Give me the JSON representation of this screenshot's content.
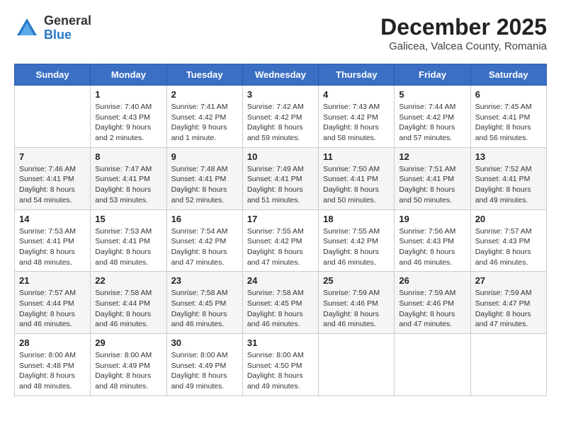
{
  "header": {
    "logo_general": "General",
    "logo_blue": "Blue",
    "month_title": "December 2025",
    "subtitle": "Galicea, Valcea County, Romania"
  },
  "days_of_week": [
    "Sunday",
    "Monday",
    "Tuesday",
    "Wednesday",
    "Thursday",
    "Friday",
    "Saturday"
  ],
  "weeks": [
    [
      {
        "day": "",
        "content": ""
      },
      {
        "day": "1",
        "content": "Sunrise: 7:40 AM\nSunset: 4:43 PM\nDaylight: 9 hours\nand 2 minutes."
      },
      {
        "day": "2",
        "content": "Sunrise: 7:41 AM\nSunset: 4:42 PM\nDaylight: 9 hours\nand 1 minute."
      },
      {
        "day": "3",
        "content": "Sunrise: 7:42 AM\nSunset: 4:42 PM\nDaylight: 8 hours\nand 59 minutes."
      },
      {
        "day": "4",
        "content": "Sunrise: 7:43 AM\nSunset: 4:42 PM\nDaylight: 8 hours\nand 58 minutes."
      },
      {
        "day": "5",
        "content": "Sunrise: 7:44 AM\nSunset: 4:42 PM\nDaylight: 8 hours\nand 57 minutes."
      },
      {
        "day": "6",
        "content": "Sunrise: 7:45 AM\nSunset: 4:41 PM\nDaylight: 8 hours\nand 56 minutes."
      }
    ],
    [
      {
        "day": "7",
        "content": "Sunrise: 7:46 AM\nSunset: 4:41 PM\nDaylight: 8 hours\nand 54 minutes."
      },
      {
        "day": "8",
        "content": "Sunrise: 7:47 AM\nSunset: 4:41 PM\nDaylight: 8 hours\nand 53 minutes."
      },
      {
        "day": "9",
        "content": "Sunrise: 7:48 AM\nSunset: 4:41 PM\nDaylight: 8 hours\nand 52 minutes."
      },
      {
        "day": "10",
        "content": "Sunrise: 7:49 AM\nSunset: 4:41 PM\nDaylight: 8 hours\nand 51 minutes."
      },
      {
        "day": "11",
        "content": "Sunrise: 7:50 AM\nSunset: 4:41 PM\nDaylight: 8 hours\nand 50 minutes."
      },
      {
        "day": "12",
        "content": "Sunrise: 7:51 AM\nSunset: 4:41 PM\nDaylight: 8 hours\nand 50 minutes."
      },
      {
        "day": "13",
        "content": "Sunrise: 7:52 AM\nSunset: 4:41 PM\nDaylight: 8 hours\nand 49 minutes."
      }
    ],
    [
      {
        "day": "14",
        "content": "Sunrise: 7:53 AM\nSunset: 4:41 PM\nDaylight: 8 hours\nand 48 minutes."
      },
      {
        "day": "15",
        "content": "Sunrise: 7:53 AM\nSunset: 4:41 PM\nDaylight: 8 hours\nand 48 minutes."
      },
      {
        "day": "16",
        "content": "Sunrise: 7:54 AM\nSunset: 4:42 PM\nDaylight: 8 hours\nand 47 minutes."
      },
      {
        "day": "17",
        "content": "Sunrise: 7:55 AM\nSunset: 4:42 PM\nDaylight: 8 hours\nand 47 minutes."
      },
      {
        "day": "18",
        "content": "Sunrise: 7:55 AM\nSunset: 4:42 PM\nDaylight: 8 hours\nand 46 minutes."
      },
      {
        "day": "19",
        "content": "Sunrise: 7:56 AM\nSunset: 4:43 PM\nDaylight: 8 hours\nand 46 minutes."
      },
      {
        "day": "20",
        "content": "Sunrise: 7:57 AM\nSunset: 4:43 PM\nDaylight: 8 hours\nand 46 minutes."
      }
    ],
    [
      {
        "day": "21",
        "content": "Sunrise: 7:57 AM\nSunset: 4:44 PM\nDaylight: 8 hours\nand 46 minutes."
      },
      {
        "day": "22",
        "content": "Sunrise: 7:58 AM\nSunset: 4:44 PM\nDaylight: 8 hours\nand 46 minutes."
      },
      {
        "day": "23",
        "content": "Sunrise: 7:58 AM\nSunset: 4:45 PM\nDaylight: 8 hours\nand 46 minutes."
      },
      {
        "day": "24",
        "content": "Sunrise: 7:58 AM\nSunset: 4:45 PM\nDaylight: 8 hours\nand 46 minutes."
      },
      {
        "day": "25",
        "content": "Sunrise: 7:59 AM\nSunset: 4:46 PM\nDaylight: 8 hours\nand 46 minutes."
      },
      {
        "day": "26",
        "content": "Sunrise: 7:59 AM\nSunset: 4:46 PM\nDaylight: 8 hours\nand 47 minutes."
      },
      {
        "day": "27",
        "content": "Sunrise: 7:59 AM\nSunset: 4:47 PM\nDaylight: 8 hours\nand 47 minutes."
      }
    ],
    [
      {
        "day": "28",
        "content": "Sunrise: 8:00 AM\nSunset: 4:48 PM\nDaylight: 8 hours\nand 48 minutes."
      },
      {
        "day": "29",
        "content": "Sunrise: 8:00 AM\nSunset: 4:49 PM\nDaylight: 8 hours\nand 48 minutes."
      },
      {
        "day": "30",
        "content": "Sunrise: 8:00 AM\nSunset: 4:49 PM\nDaylight: 8 hours\nand 49 minutes."
      },
      {
        "day": "31",
        "content": "Sunrise: 8:00 AM\nSunset: 4:50 PM\nDaylight: 8 hours\nand 49 minutes."
      },
      {
        "day": "",
        "content": ""
      },
      {
        "day": "",
        "content": ""
      },
      {
        "day": "",
        "content": ""
      }
    ]
  ]
}
